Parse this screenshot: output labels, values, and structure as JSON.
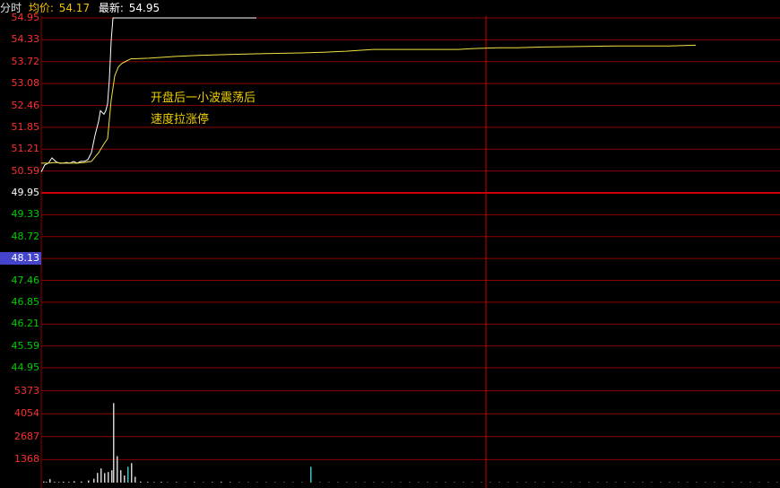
{
  "header": {
    "label_time": "分时",
    "avg_label": "均价:",
    "avg_value": "54.17",
    "last_label": "最新:",
    "last_value": "54.95"
  },
  "colors": {
    "up": "#ff3030",
    "down": "#00d000",
    "neutral": "#ffffff",
    "grid": "#8a0000",
    "midline": "#cc0000",
    "price_line": "#ffffff",
    "avg_line": "#f0e040",
    "volume_bar": "#d0d0d0",
    "volume_bar_alt": "#40c0c0",
    "annotation": "#f0d000"
  },
  "price_axis": [
    {
      "label": "54.95",
      "side": "up"
    },
    {
      "label": "54.33",
      "side": "up"
    },
    {
      "label": "53.72",
      "side": "up"
    },
    {
      "label": "53.08",
      "side": "up"
    },
    {
      "label": "52.46",
      "side": "up"
    },
    {
      "label": "51.85",
      "side": "up"
    },
    {
      "label": "51.21",
      "side": "up"
    },
    {
      "label": "50.59",
      "side": "up"
    },
    {
      "label": "49.95",
      "side": "neutral"
    },
    {
      "label": "49.33",
      "side": "down"
    },
    {
      "label": "48.72",
      "side": "down"
    },
    {
      "label": "48.13",
      "side": "down",
      "highlight": true
    },
    {
      "label": "47.46",
      "side": "down"
    },
    {
      "label": "46.85",
      "side": "down"
    },
    {
      "label": "46.21",
      "side": "down"
    },
    {
      "label": "45.59",
      "side": "down"
    },
    {
      "label": "44.95",
      "side": "down"
    }
  ],
  "volume_axis": [
    "5373",
    "4054",
    "2687",
    "1368"
  ],
  "annotation": {
    "line1": "开盘后一小波震荡后",
    "line2": "速度拉涨停"
  },
  "chart_data": {
    "type": "line",
    "prev_close": 49.95,
    "ylim": [
      44.95,
      54.95
    ],
    "x_range": [
      0,
      240
    ],
    "series": [
      {
        "key": "price",
        "color": "#ffffff",
        "points": [
          [
            0,
            50.55
          ],
          [
            4,
            50.75
          ],
          [
            8,
            50.8
          ],
          [
            12,
            50.95
          ],
          [
            16,
            50.85
          ],
          [
            20,
            50.8
          ],
          [
            24,
            50.8
          ],
          [
            28,
            50.82
          ],
          [
            32,
            50.8
          ],
          [
            36,
            50.85
          ],
          [
            40,
            50.8
          ],
          [
            44,
            50.85
          ],
          [
            48,
            50.85
          ],
          [
            52,
            50.9
          ],
          [
            56,
            51.1
          ],
          [
            60,
            51.6
          ],
          [
            64,
            52.0
          ],
          [
            66,
            52.3
          ],
          [
            70,
            52.2
          ],
          [
            72,
            52.3
          ],
          [
            74,
            52.5
          ],
          [
            76,
            53.2
          ],
          [
            78,
            54.3
          ],
          [
            80,
            54.95
          ],
          [
            85,
            54.95
          ],
          [
            240,
            54.95
          ]
        ]
      },
      {
        "key": "average",
        "color": "#f0e040",
        "points": [
          [
            0,
            50.8
          ],
          [
            8,
            50.8
          ],
          [
            16,
            50.82
          ],
          [
            24,
            50.8
          ],
          [
            32,
            50.8
          ],
          [
            40,
            50.8
          ],
          [
            48,
            50.82
          ],
          [
            56,
            50.85
          ],
          [
            64,
            51.1
          ],
          [
            70,
            51.35
          ],
          [
            74,
            51.5
          ],
          [
            78,
            52.6
          ],
          [
            82,
            53.3
          ],
          [
            86,
            53.55
          ],
          [
            90,
            53.65
          ],
          [
            95,
            53.72
          ],
          [
            100,
            53.78
          ],
          [
            120,
            53.8
          ],
          [
            150,
            53.85
          ],
          [
            175,
            53.88
          ],
          [
            200,
            53.9
          ],
          [
            250,
            53.93
          ],
          [
            290,
            53.95
          ],
          [
            315,
            53.97
          ],
          [
            340,
            54.0
          ],
          [
            370,
            54.05
          ],
          [
            400,
            54.05
          ],
          [
            430,
            54.05
          ],
          [
            450,
            54.05
          ],
          [
            465,
            54.05
          ],
          [
            480,
            54.07
          ],
          [
            490,
            54.08
          ],
          [
            510,
            54.1
          ],
          [
            530,
            54.1
          ],
          [
            560,
            54.12
          ],
          [
            590,
            54.13
          ],
          [
            640,
            54.15
          ],
          [
            700,
            54.15
          ],
          [
            730,
            54.17
          ]
        ]
      }
    ],
    "volume": {
      "ylim": [
        0,
        6500
      ],
      "bars": [
        [
          2,
          60
        ],
        [
          5,
          40
        ],
        [
          9,
          200
        ],
        [
          14,
          40
        ],
        [
          19,
          30
        ],
        [
          24,
          50
        ],
        [
          30,
          40
        ],
        [
          36,
          80
        ],
        [
          44,
          60
        ],
        [
          52,
          120
        ],
        [
          58,
          220
        ],
        [
          62,
          550
        ],
        [
          66,
          800
        ],
        [
          70,
          540
        ],
        [
          74,
          600
        ],
        [
          78,
          700
        ],
        [
          80,
          4500
        ],
        [
          84,
          1500
        ],
        [
          88,
          700
        ],
        [
          92,
          400
        ],
        [
          96,
          900
        ],
        [
          100,
          1100
        ],
        [
          104,
          330
        ],
        [
          110,
          60
        ],
        [
          118,
          40
        ],
        [
          125,
          30
        ],
        [
          133,
          40
        ],
        [
          140,
          20
        ],
        [
          150,
          30
        ],
        [
          160,
          20
        ],
        [
          170,
          30
        ],
        [
          180,
          20
        ],
        [
          190,
          30
        ],
        [
          200,
          40
        ],
        [
          210,
          30
        ],
        [
          220,
          20
        ],
        [
          230,
          20
        ],
        [
          240,
          20
        ],
        [
          250,
          20
        ],
        [
          260,
          20
        ],
        [
          270,
          20
        ],
        [
          280,
          20
        ],
        [
          290,
          20
        ],
        [
          300,
          900
        ],
        [
          310,
          20
        ],
        [
          320,
          20
        ],
        [
          330,
          20
        ],
        [
          340,
          20
        ],
        [
          350,
          20
        ],
        [
          360,
          20
        ],
        [
          370,
          20
        ],
        [
          380,
          20
        ],
        [
          390,
          20
        ],
        [
          400,
          20
        ],
        [
          410,
          20
        ],
        [
          420,
          20
        ],
        [
          430,
          20
        ],
        [
          440,
          20
        ],
        [
          450,
          20
        ],
        [
          460,
          20
        ],
        [
          470,
          20
        ],
        [
          480,
          20
        ],
        [
          490,
          20
        ],
        [
          500,
          20
        ],
        [
          510,
          20
        ],
        [
          520,
          20
        ],
        [
          530,
          20
        ],
        [
          540,
          20
        ],
        [
          550,
          20
        ],
        [
          560,
          20
        ],
        [
          570,
          20
        ],
        [
          580,
          20
        ],
        [
          590,
          20
        ],
        [
          600,
          20
        ],
        [
          610,
          20
        ],
        [
          620,
          20
        ],
        [
          630,
          20
        ],
        [
          640,
          20
        ],
        [
          650,
          20
        ],
        [
          660,
          20
        ],
        [
          670,
          20
        ],
        [
          680,
          20
        ],
        [
          690,
          20
        ],
        [
          700,
          20
        ],
        [
          710,
          20
        ],
        [
          720,
          20
        ],
        [
          730,
          20
        ],
        [
          740,
          20
        ],
        [
          750,
          20
        ],
        [
          760,
          20
        ],
        [
          770,
          20
        ],
        [
          780,
          20
        ],
        [
          790,
          20
        ],
        [
          800,
          20
        ],
        [
          810,
          20
        ],
        [
          820,
          20
        ]
      ]
    }
  }
}
